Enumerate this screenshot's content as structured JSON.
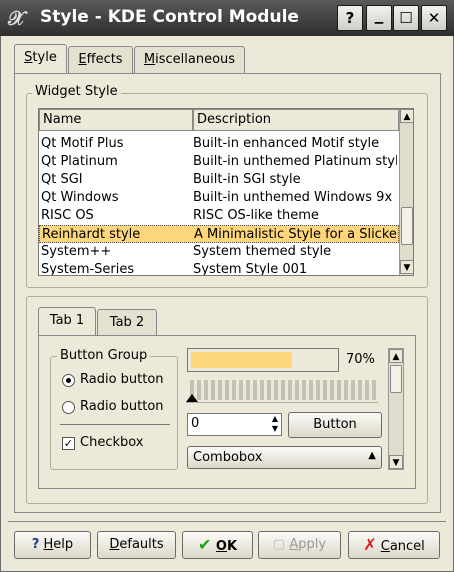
{
  "window": {
    "title": "Style - KDE Control Module",
    "controls": {
      "help": "?",
      "minimize": "▁",
      "maximize": "☐",
      "close": "✕"
    }
  },
  "tabs": [
    {
      "label": "Style",
      "mnemonic": "S",
      "rest": "tyle"
    },
    {
      "label": "Effects",
      "mnemonic": "E",
      "rest": "ffects"
    },
    {
      "label": "Miscellaneous",
      "mnemonic": "M",
      "rest": "iscellaneous"
    }
  ],
  "widget_style": {
    "group_label": "Widget Style",
    "columns": [
      "Name",
      "Description"
    ],
    "rows": [
      {
        "name": "Qt Motif Plus",
        "description": "Built-in enhanced Motif style"
      },
      {
        "name": "Qt Platinum",
        "description": "Built-in unthemed Platinum style"
      },
      {
        "name": "Qt SGI",
        "description": "Built-in SGI style"
      },
      {
        "name": "Qt Windows",
        "description": "Built-in unthemed Windows 9x ..."
      },
      {
        "name": "RISC OS",
        "description": "RISC OS-like theme"
      },
      {
        "name": "Reinhardt style",
        "description": "A Minimalistic Style for a Slicke...",
        "selected": true
      },
      {
        "name": "System++",
        "description": "System themed style"
      },
      {
        "name": "System-Series",
        "description": "System Style 001"
      }
    ]
  },
  "preview": {
    "tabs": [
      "Tab 1",
      "Tab 2"
    ],
    "button_group": {
      "label": "Button Group",
      "radio1": "Radio button",
      "radio2": "Radio button",
      "checkbox": "Checkbox"
    },
    "progress": {
      "value": 0.7,
      "label": "70%"
    },
    "spin_value": "0",
    "button_label": "Button",
    "combo_value": "Combobox",
    "colors": {
      "progress_fill": "#fdd57a",
      "selection": "#fdd57a"
    }
  },
  "footer": {
    "help": {
      "mnemonic": "H",
      "rest": "elp"
    },
    "defaults": {
      "mnemonic": "D",
      "rest": "efaults"
    },
    "ok": {
      "mnemonic": "O",
      "rest": "K"
    },
    "apply": {
      "mnemonic": "A",
      "rest": "pply"
    },
    "cancel": {
      "mnemonic": "C",
      "rest": "ancel"
    }
  }
}
